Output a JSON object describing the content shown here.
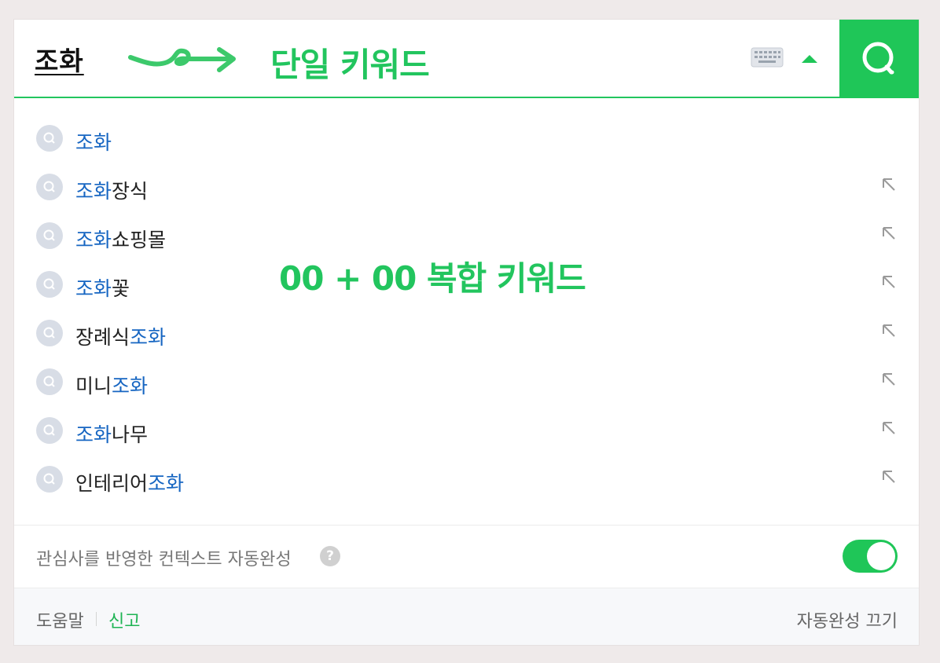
{
  "search": {
    "query": "조화",
    "button_label": "search"
  },
  "annotations": {
    "single": "단일 키워드",
    "compound": "00 + 00 복합 키워드"
  },
  "suggestions": [
    {
      "pre": "",
      "hl": "조화",
      "post": "",
      "arrow": false
    },
    {
      "pre": "",
      "hl": "조화",
      "post": "장식",
      "arrow": true
    },
    {
      "pre": "",
      "hl": "조화",
      "post": "쇼핑몰",
      "arrow": true
    },
    {
      "pre": "",
      "hl": "조화",
      "post": "꽃",
      "arrow": true
    },
    {
      "pre": "장례식",
      "hl": "조화",
      "post": "",
      "arrow": true
    },
    {
      "pre": "미니",
      "hl": "조화",
      "post": "",
      "arrow": true
    },
    {
      "pre": "",
      "hl": "조화",
      "post": "나무",
      "arrow": true
    },
    {
      "pre": "인테리어",
      "hl": "조화",
      "post": "",
      "arrow": true
    }
  ],
  "context": {
    "label": "관심사를 반영한 컨텍스트 자동완성",
    "help": "?",
    "toggle_on": true
  },
  "footer": {
    "help": "도움말",
    "report": "신고",
    "turn_off": "자동완성 끄기"
  },
  "colors": {
    "accent": "#1fc658",
    "highlight": "#1766c2",
    "annotation": "#22c55e"
  },
  "icons": [
    "squiggle-arrow-icon",
    "keyboard-icon",
    "caret-up-icon",
    "search-icon",
    "suggest-search-icon",
    "insert-arrow-icon",
    "help-icon",
    "toggle-switch"
  ]
}
